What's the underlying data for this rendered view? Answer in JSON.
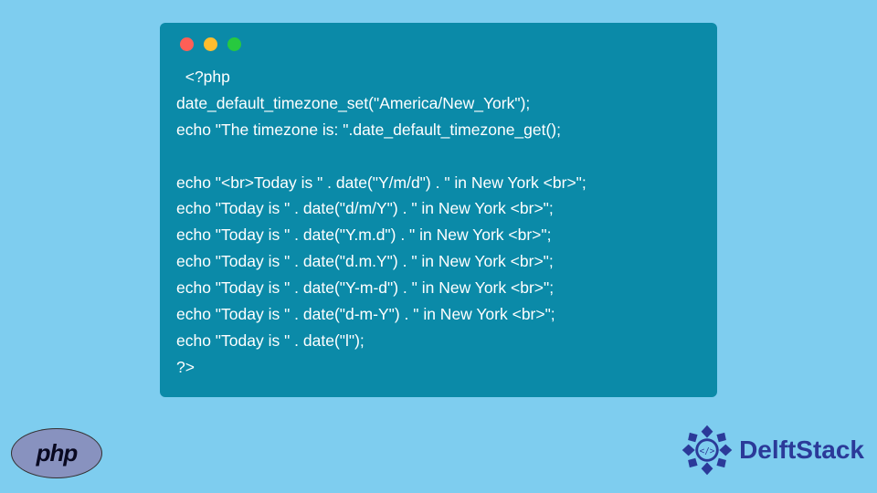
{
  "code": {
    "l1": "  <?php",
    "l2": "date_default_timezone_set(\"America/New_York\");",
    "l3": "echo \"The timezone is: \".date_default_timezone_get();",
    "l4": "",
    "l5": "echo \"<br>Today is \" . date(\"Y/m/d\") . \" in New York <br>\";",
    "l6": "echo \"Today is \" . date(\"d/m/Y\") . \" in New York <br>\";",
    "l7": "echo \"Today is \" . date(\"Y.m.d\") . \" in New York <br>\";",
    "l8": "echo \"Today is \" . date(\"d.m.Y\") . \" in New York <br>\";",
    "l9": "echo \"Today is \" . date(\"Y-m-d\") . \" in New York <br>\";",
    "l10": "echo \"Today is \" . date(\"d-m-Y\") . \" in New York <br>\";",
    "l11": "echo \"Today is \" . date(\"l\");",
    "l12": "?>"
  },
  "logos": {
    "php": "php",
    "brand": "DelftStack"
  }
}
